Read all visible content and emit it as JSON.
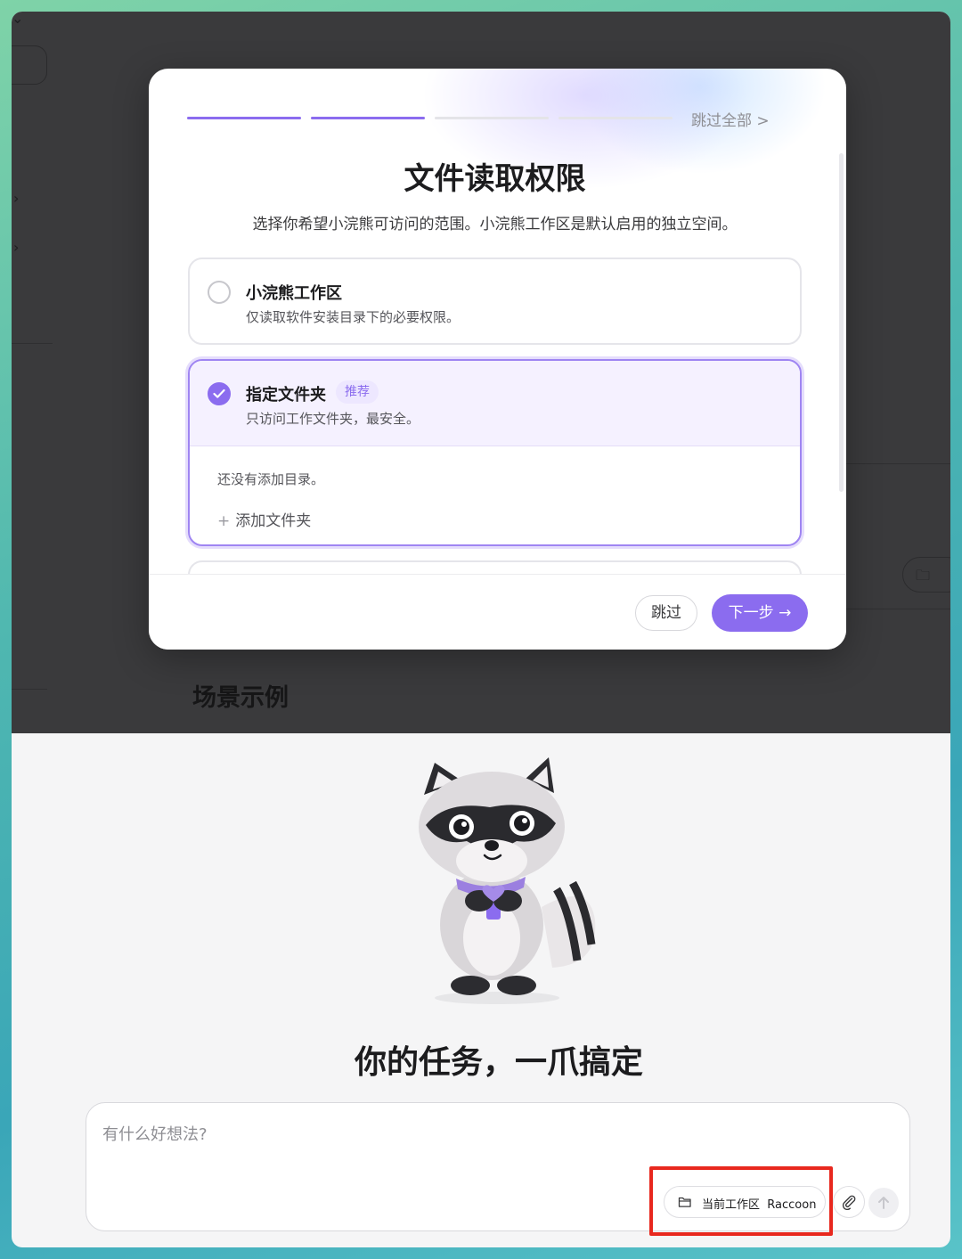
{
  "modal": {
    "skip_all": "跳过全部 >",
    "title": "文件读取权限",
    "subtitle": "选择你希望小浣熊可访问的范围。小浣熊工作区是默认启用的独立空间。",
    "steps_total": 4,
    "steps_completed": 2,
    "options": [
      {
        "title": "小浣熊工作区",
        "desc": "仅读取软件安装目录下的必要权限。",
        "selected": false
      },
      {
        "title": "指定文件夹",
        "badge": "推荐",
        "desc": "只访问工作文件夹，最安全。",
        "selected": true,
        "empty_text": "还没有添加目录。",
        "add_label": "添加文件夹"
      }
    ],
    "skip_button": "跳过",
    "next_button": "下一步 →"
  },
  "background": {
    "section_title": "场景示例"
  },
  "main": {
    "tagline": "你的任务，一爪搞定",
    "composer": {
      "placeholder": "有什么好想法?",
      "workspace_label": "当前工作区",
      "workspace_name": "Raccoon"
    }
  },
  "colors": {
    "accent": "#8b6cef",
    "highlight": "#e8281e"
  }
}
